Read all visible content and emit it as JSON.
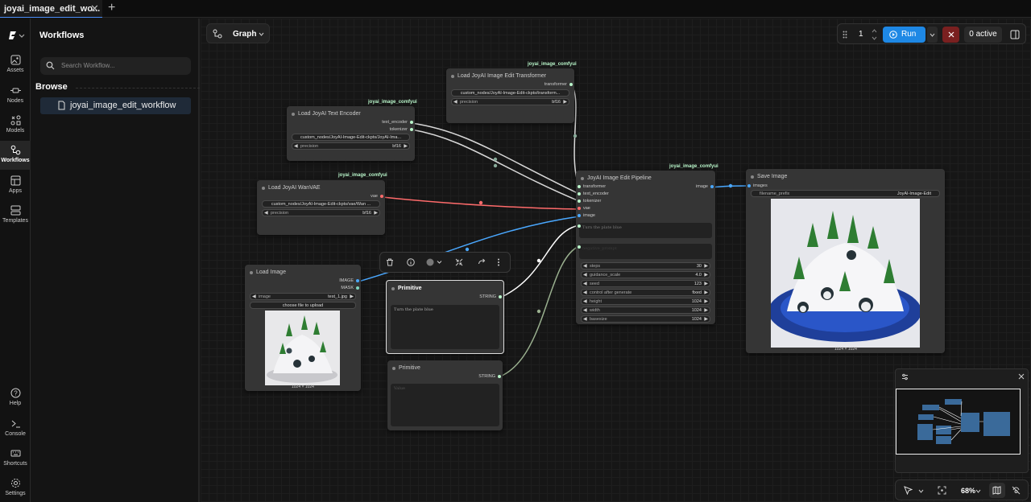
{
  "tab": {
    "title": "joyai_image_edit_wo...",
    "close": "✕",
    "add": "+"
  },
  "iconbar": {
    "items": [
      {
        "label": "Assets"
      },
      {
        "label": "Nodes"
      },
      {
        "label": "Models"
      },
      {
        "label": "Workflows"
      },
      {
        "label": "Apps"
      },
      {
        "label": "Templates"
      },
      {
        "label": "Help"
      },
      {
        "label": "Console"
      },
      {
        "label": "Shortcuts"
      },
      {
        "label": "Settings"
      }
    ]
  },
  "panel": {
    "title": "Workflows",
    "search_placeholder": "Search Workflow...",
    "browse": "Browse",
    "item": "joyai_image_edit_workflow"
  },
  "canvas": {
    "graph_label": "Graph",
    "run_count": "1",
    "run_label": "Run",
    "active_label": "0 active",
    "zoom": "68%"
  },
  "nodes": {
    "transformer": {
      "tag": "joyai_image_comfyui",
      "title": "Load JoyAI Image Edit Transformer",
      "out": "transformer",
      "path": "custom_nodes/JoyAI-Image-Edit-ckpts/transform...",
      "precision_label": "precision",
      "precision_value": "bf16"
    },
    "text_encoder": {
      "tag": "joyai_image_comfyui",
      "title": "Load JoyAI Text Encoder",
      "out1": "text_encoder",
      "out2": "tokenizer",
      "path": "custom_nodes/JoyAI-Image-Edit-ckpts/JoyAI-Ima...",
      "precision_label": "precision",
      "precision_value": "bf16"
    },
    "vae": {
      "tag": "joyai_image_comfyui",
      "title": "Load JoyAI WanVAE",
      "out": "vae",
      "path": "custom_nodes/JoyAI-Image-Edit-ckpts/vae/Wan ...",
      "precision_label": "precision",
      "precision_value": "bf16"
    },
    "load_image": {
      "title": "Load Image",
      "out1": "IMAGE",
      "out2": "MASK",
      "image_label": "image",
      "image_value": "test_1.jpg",
      "upload": "choose file to upload",
      "size": "1024 × 1024"
    },
    "primitive1": {
      "title": "Primitive",
      "out": "STRING",
      "text": "Turn the plate blue"
    },
    "primitive2": {
      "title": "Primitive",
      "out": "STRING",
      "text": "Value"
    },
    "pipeline": {
      "tag": "joyai_image_comfyui",
      "title": "JoyAI Image Edit Pipeline",
      "in": [
        "transformer",
        "text_encoder",
        "tokenizer",
        "vae",
        "image"
      ],
      "out": "image",
      "prompt": "Turn the plate blue",
      "neg_prompt": "negative_prompt",
      "params": [
        {
          "label": "steps",
          "value": "30"
        },
        {
          "label": "guidance_scale",
          "value": "4.0"
        },
        {
          "label": "seed",
          "value": "123"
        },
        {
          "label": "control after generate",
          "value": "fixed"
        },
        {
          "label": "height",
          "value": "1024"
        },
        {
          "label": "width",
          "value": "1024"
        },
        {
          "label": "basesize",
          "value": "1024"
        }
      ]
    },
    "save": {
      "title": "Save Image",
      "in": "images",
      "prefix_label": "filename_prefix",
      "prefix_value": "JoyAI-Image-Edit",
      "size": "1024 × 1024"
    }
  },
  "colors": {
    "accent": "#1e88e5",
    "link_blue": "#4aa8ff",
    "link_red": "#ff6b6b",
    "link_white": "#d8d8d8",
    "node_bg": "#353535"
  }
}
